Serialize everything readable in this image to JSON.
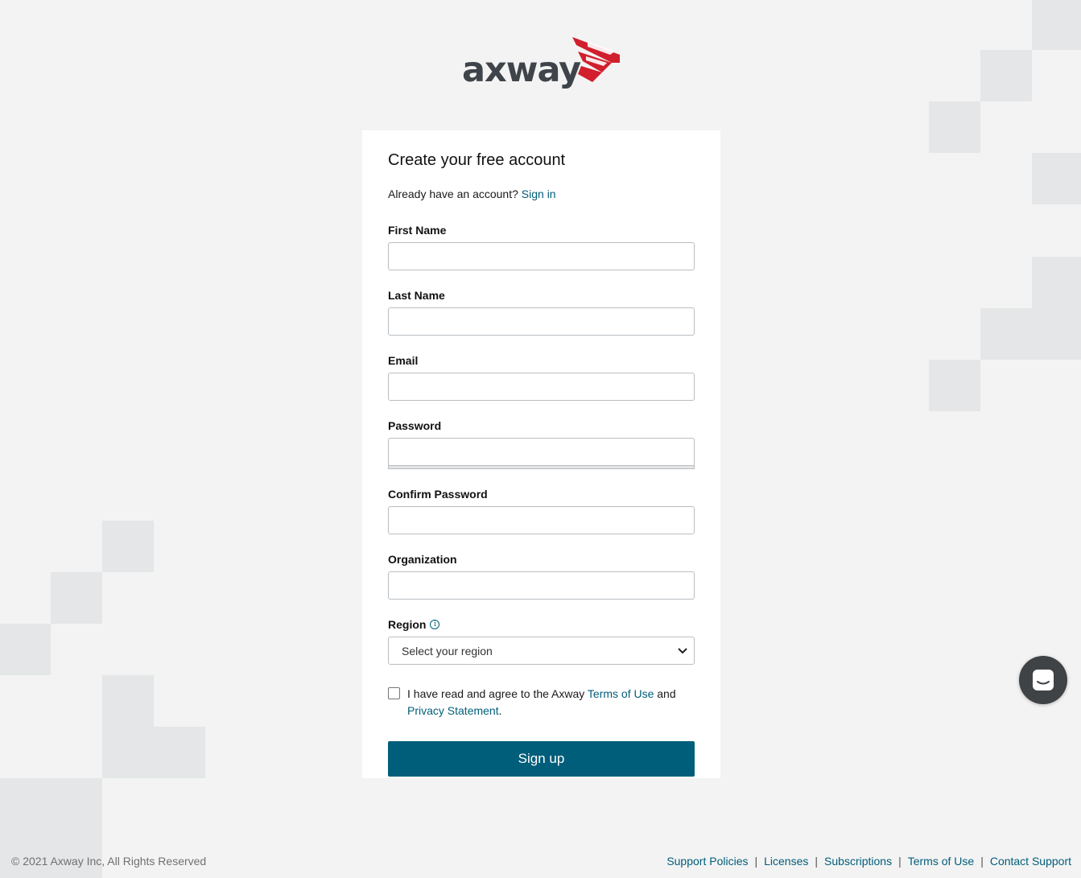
{
  "brand": {
    "name": "axway",
    "accent_color": "#d11f2d",
    "text_color": "#3e444a"
  },
  "form": {
    "title": "Create your free account",
    "signin_prompt": "Already have an account?",
    "signin_link": "Sign in",
    "fields": {
      "first_name": {
        "label": "First Name",
        "value": ""
      },
      "last_name": {
        "label": "Last Name",
        "value": ""
      },
      "email": {
        "label": "Email",
        "value": ""
      },
      "password": {
        "label": "Password",
        "value": ""
      },
      "confirm_password": {
        "label": "Confirm Password",
        "value": ""
      },
      "organization": {
        "label": "Organization",
        "value": ""
      }
    },
    "region": {
      "label": "Region",
      "info_icon": "info-icon",
      "selected": "Select your region"
    },
    "terms": {
      "checked": false,
      "prefix": "I have read and agree to the Axway",
      "terms_link": "Terms of Use",
      "conjunction": "and",
      "privacy_link": "Privacy Statement",
      "suffix": "."
    },
    "submit_label": "Sign up"
  },
  "chat": {
    "icon": "chat-icon"
  },
  "footer": {
    "copyright": "© 2021 Axway Inc, All Rights Reserved",
    "links": [
      "Support Policies",
      "Licenses",
      "Subscriptions",
      "Terms of Use",
      "Contact Support"
    ],
    "separator": "|"
  },
  "colors": {
    "primary": "#005e7a",
    "background": "#f3f3f3",
    "tile": "#e4e6e7"
  }
}
